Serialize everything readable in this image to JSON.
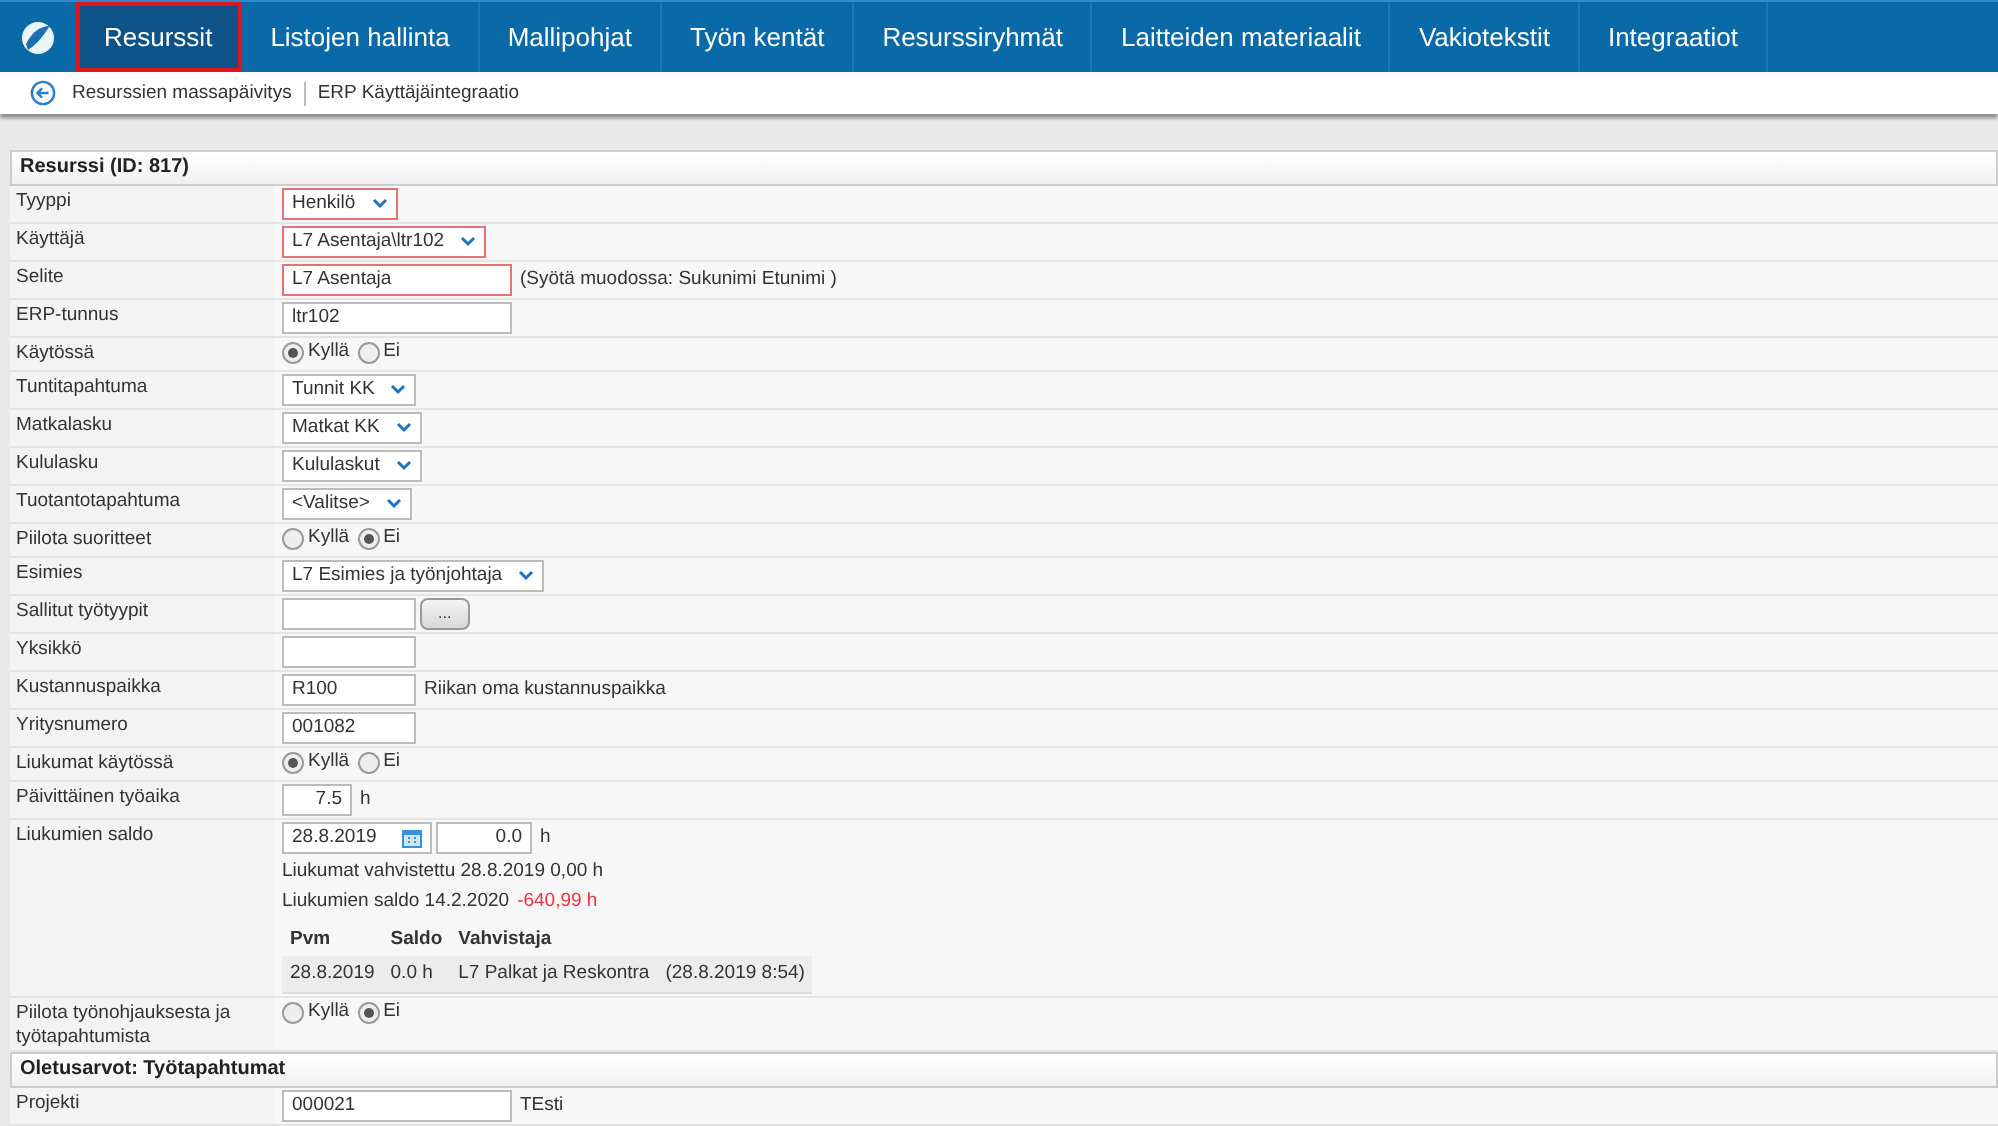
{
  "nav": {
    "tabs": [
      {
        "label": "Resurssit",
        "selected": true
      },
      {
        "label": "Listojen hallinta",
        "selected": false
      },
      {
        "label": "Mallipohjat",
        "selected": false
      },
      {
        "label": "Työn kentät",
        "selected": false
      },
      {
        "label": "Resurssiryhmät",
        "selected": false
      },
      {
        "label": "Laitteiden materiaalit",
        "selected": false
      },
      {
        "label": "Vakiotekstit",
        "selected": false
      },
      {
        "label": "Integraatiot",
        "selected": false
      }
    ]
  },
  "subnav": {
    "links": [
      "Resurssien massapäivitys",
      "ERP Käyttäjäintegraatio"
    ]
  },
  "sections": [
    {
      "title": "Resurssi (ID: 817)",
      "rows": [
        {
          "label": "Tyyppi",
          "kind": "select",
          "value": "Henkilö",
          "invalid": true
        },
        {
          "label": "Käyttäjä",
          "kind": "select",
          "value": "L7 Asentaja\\ltr102",
          "invalid": true
        },
        {
          "label": "Selite",
          "kind": "text",
          "value": "L7 Asentaja",
          "invalid": true,
          "note": "(Syötä muodossa: Sukunimi Etunimi )"
        },
        {
          "label": "ERP-tunnus",
          "kind": "text",
          "value": "ltr102",
          "invalid": false
        },
        {
          "label": "Käytössä",
          "kind": "radio",
          "options": [
            {
              "label": "Kyllä",
              "selected": true
            },
            {
              "label": "Ei",
              "selected": false
            }
          ]
        },
        {
          "label": "Tuntitapahtuma",
          "kind": "select",
          "value": "Tunnit KK",
          "invalid": false
        },
        {
          "label": "Matkalasku",
          "kind": "select",
          "value": "Matkat KK",
          "invalid": false
        },
        {
          "label": "Kululasku",
          "kind": "select",
          "value": "Kululaskut",
          "invalid": false
        },
        {
          "label": "Tuotantotapahtuma",
          "kind": "select",
          "value": "<Valitse>",
          "invalid": false
        },
        {
          "label": "Piilota suoritteet",
          "kind": "radio",
          "options": [
            {
              "label": "Kyllä",
              "selected": false
            },
            {
              "label": "Ei",
              "selected": true
            }
          ]
        },
        {
          "label": "Esimies",
          "kind": "select",
          "value": "L7 Esimies ja työnjohtaja",
          "invalid": false
        },
        {
          "label": "Sallitut työtyypit",
          "kind": "picker",
          "button": "..."
        },
        {
          "label": "Yksikkö",
          "kind": "short"
        },
        {
          "label": "Kustannuspaikka",
          "kind": "short",
          "value": "R100",
          "note": "Riikan oma kustannuspaikka"
        },
        {
          "label": "Yritysnumero",
          "kind": "short",
          "value": "001082"
        },
        {
          "label": "Liukumat käytössä",
          "kind": "radio",
          "options": [
            {
              "label": "Kyllä",
              "selected": true
            },
            {
              "label": "Ei",
              "selected": false
            }
          ]
        },
        {
          "label": "Päivittäinen työaika",
          "kind": "hours",
          "value": "7.5",
          "unit": "h"
        },
        {
          "label": "Liukumien saldo",
          "kind": "saldo",
          "date": "28.8.2019",
          "value": "0.0",
          "unit": "h",
          "confirmed": "Liukumat vahvistettu 28.8.2019 0,00 h",
          "balance_label": "Liukumien saldo 14.2.2020",
          "balance_value": "-640,99 h",
          "table": {
            "columns": [
              "Pvm",
              "Saldo",
              "Vahvistaja"
            ],
            "rows": [
              [
                "28.8.2019",
                "0.0 h",
                "L7 Palkat ja Reskontra",
                "(28.8.2019 8:54)"
              ]
            ]
          }
        },
        {
          "label": "Piilota työnohjauksesta ja työtapahtumista",
          "kind": "radio",
          "options": [
            {
              "label": "Kyllä",
              "selected": false
            },
            {
              "label": "Ei",
              "selected": true
            }
          ]
        }
      ]
    },
    {
      "title": "Oletusarvot: Työtapahtumat",
      "rows": [
        {
          "label": "Projekti",
          "kind": "text",
          "value": "000021",
          "invalid": false,
          "note": "TEsti"
        }
      ]
    }
  ]
}
